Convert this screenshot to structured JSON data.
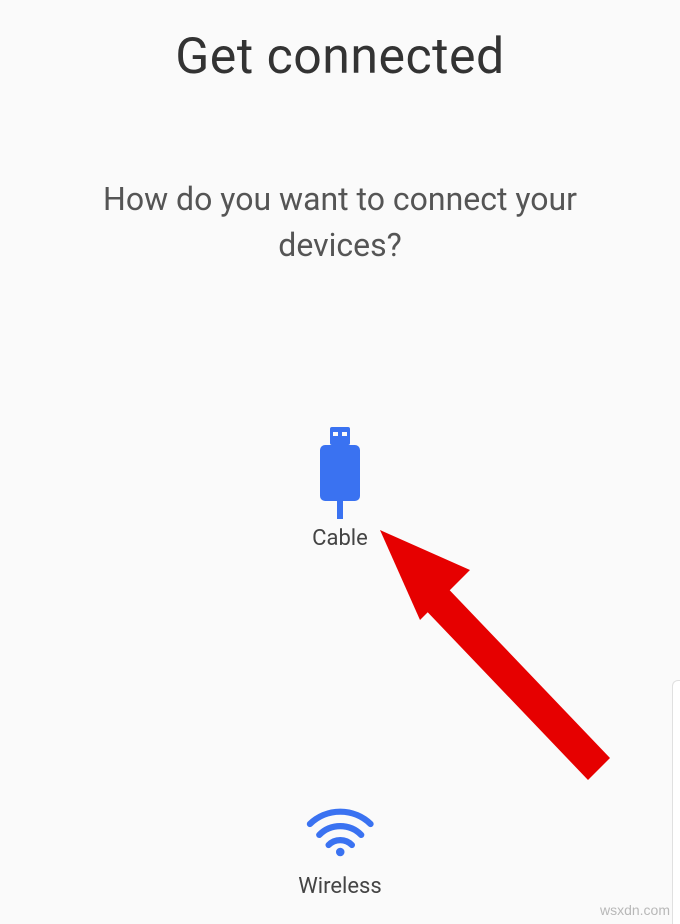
{
  "title": "Get connected",
  "subtitle": "How do you want to connect your devices?",
  "options": {
    "cable": {
      "label": "Cable"
    },
    "wireless": {
      "label": "Wireless"
    }
  },
  "watermark": "wsxdn.com",
  "colors": {
    "accent": "#3a72f1",
    "annotation": "#e60000"
  }
}
